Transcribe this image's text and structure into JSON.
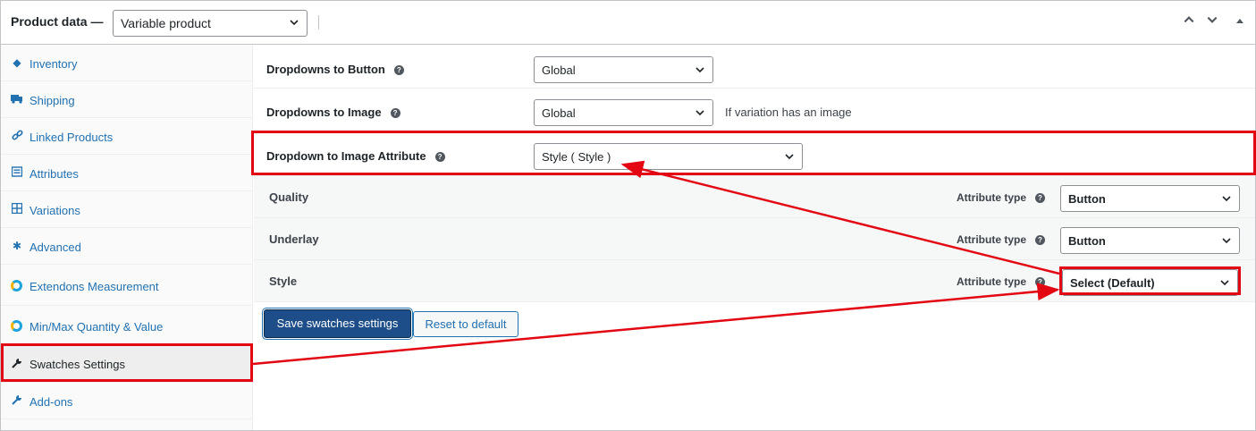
{
  "header": {
    "title": "Product data —",
    "product_type": "Variable product",
    "controls": [
      "chevron-up",
      "chevron-down",
      "collapse-toggle"
    ]
  },
  "sidebar": {
    "items": [
      {
        "label": "Inventory",
        "icon": "tag-icon",
        "active": false
      },
      {
        "label": "Shipping",
        "icon": "truck-icon",
        "active": false
      },
      {
        "label": "Linked Products",
        "icon": "link-icon",
        "active": false
      },
      {
        "label": "Attributes",
        "icon": "list-icon",
        "active": false
      },
      {
        "label": "Variations",
        "icon": "grid-icon",
        "active": false
      },
      {
        "label": "Advanced",
        "icon": "gear-icon",
        "active": false
      },
      {
        "label": "Extendons Measurement",
        "icon": "extendons-icon",
        "active": false
      },
      {
        "label": "Min/Max Quantity & Value",
        "icon": "extendons-icon",
        "active": false
      },
      {
        "label": "Swatches Settings",
        "icon": "wrench-icon",
        "active": true
      },
      {
        "label": "Add-ons",
        "icon": "wrench-icon",
        "active": false
      }
    ]
  },
  "settings": {
    "dropdowns_to_button": {
      "label": "Dropdowns to Button",
      "value": "Global"
    },
    "dropdowns_to_image": {
      "label": "Dropdowns to Image",
      "value": "Global",
      "note": "If variation has an image"
    },
    "dropdown_to_image_attribute": {
      "label": "Dropdown to Image Attribute",
      "value": "Style ( Style )"
    }
  },
  "attributes": {
    "type_label": "Attribute type",
    "rows": [
      {
        "name": "Quality",
        "type": "Button"
      },
      {
        "name": "Underlay",
        "type": "Button"
      },
      {
        "name": "Style",
        "type": "Select (Default)"
      }
    ]
  },
  "actions": {
    "save_label": "Save swatches settings",
    "reset_label": "Reset to default"
  },
  "colors": {
    "link": "#2271b1",
    "primary_button": "#1d4e89",
    "annotation": "#e30613"
  }
}
